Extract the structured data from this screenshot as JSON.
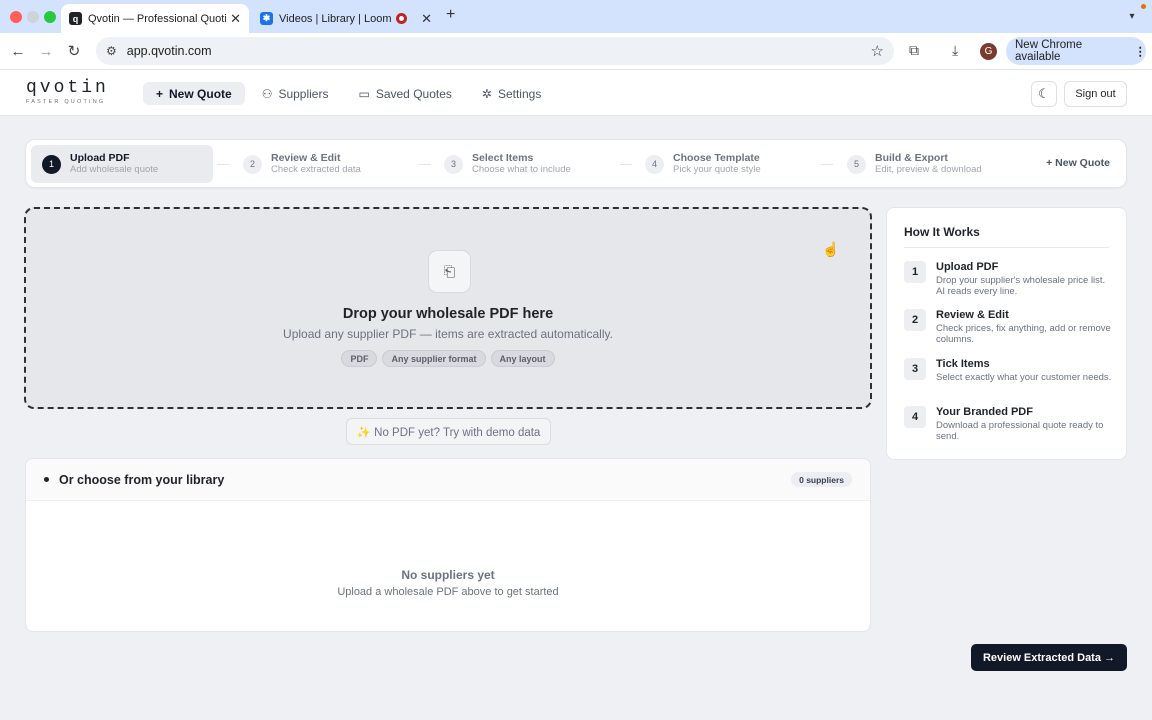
{
  "browser": {
    "tabs": [
      {
        "title": "Qvotin — Professional Quoting",
        "favicon": "q",
        "active": true
      },
      {
        "title": "Videos | Library | Loom",
        "favicon": "loom-icon",
        "active": false
      }
    ],
    "new_tab": "+",
    "url": "app.qvotin.com",
    "profile_initial": "G",
    "update_label": "New Chrome available",
    "kebab": "⋮"
  },
  "header": {
    "logo_word": "qvotin",
    "logo_tagline": "FASTER QUOTING",
    "nav": [
      {
        "label": "New Quote",
        "icon": "+",
        "active": true
      },
      {
        "label": "Suppliers",
        "icon": "person-icon",
        "active": false
      },
      {
        "label": "Saved Quotes",
        "icon": "folder-icon",
        "active": false
      },
      {
        "label": "Settings",
        "icon": "gear-icon",
        "active": false
      }
    ],
    "signout": "Sign out"
  },
  "stepper": {
    "steps": [
      {
        "num": "1",
        "title": "Upload PDF",
        "sub": "Add wholesale quote",
        "active": true
      },
      {
        "num": "2",
        "title": "Review & Edit",
        "sub": "Check extracted data",
        "active": false
      },
      {
        "num": "3",
        "title": "Select Items",
        "sub": "Choose what to include",
        "active": false
      },
      {
        "num": "4",
        "title": "Choose Template",
        "sub": "Pick your quote style",
        "active": false
      },
      {
        "num": "5",
        "title": "Build & Export",
        "sub": "Edit, preview & download",
        "active": false
      }
    ],
    "new_quote": "+ New Quote"
  },
  "dropzone": {
    "title": "Drop your wholesale PDF here",
    "subtitle": "Upload any supplier PDF — items are extracted automatically.",
    "chips": [
      "PDF",
      "Any supplier format",
      "Any layout"
    ]
  },
  "demo_button": "✨ No PDF yet? Try with demo data",
  "library": {
    "title": "Or choose from your library",
    "count": "0 suppliers",
    "empty_title": "No suppliers yet",
    "empty_sub": "Upload a wholesale PDF above to get started"
  },
  "how_it_works": {
    "title": "How It Works",
    "steps": [
      {
        "num": "1",
        "title": "Upload PDF",
        "desc": "Drop your supplier's wholesale price list. AI reads every line."
      },
      {
        "num": "2",
        "title": "Review & Edit",
        "desc": "Check prices, fix anything, add or remove columns."
      },
      {
        "num": "3",
        "title": "Tick Items",
        "desc": "Select exactly what your customer needs."
      },
      {
        "num": "4",
        "title": "Your Branded PDF",
        "desc": "Download a professional quote ready to send."
      }
    ]
  },
  "review_button": "Review Extracted Data →",
  "colors": {
    "accent": "#111827",
    "chrome_blue": "#d3e3fd"
  }
}
